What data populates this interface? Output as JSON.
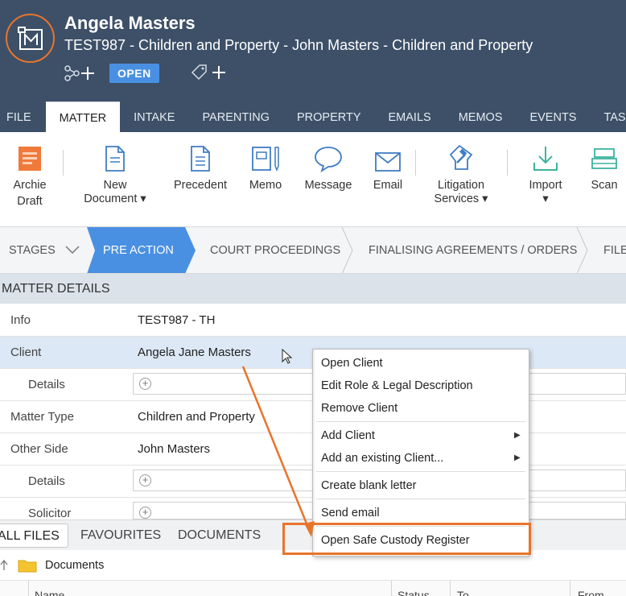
{
  "header": {
    "client_name": "Angela Masters",
    "matter_title": "TEST987 - Children and Property - John Masters - Children and Property",
    "status": "OPEN",
    "icons": [
      "matter-logo-icon",
      "relationship-icon",
      "add-icon",
      "tag-icon",
      "add-icon"
    ]
  },
  "tabs": [
    "FILE",
    "MATTER",
    "INTAKE",
    "PARENTING",
    "PROPERTY",
    "EMAILS",
    "MEMOS",
    "EVENTS",
    "TASKS"
  ],
  "active_tab": "MATTER",
  "ribbon": {
    "archie_draft": [
      "Archie",
      "Draft"
    ],
    "new_document": [
      "New",
      "Document ▾"
    ],
    "precedent": "Precedent",
    "memo": "Memo",
    "message": "Message",
    "email": "Email",
    "litigation_services": [
      "Litigation",
      "Services ▾"
    ],
    "import": [
      "Import",
      "▾"
    ],
    "scan": "Scan"
  },
  "stages": {
    "label": "STAGES",
    "items": [
      "PRE ACTION",
      "COURT PROCEEDINGS",
      "FINALISING AGREEMENTS / ORDERS",
      "FILE"
    ],
    "active": "PRE ACTION"
  },
  "matter_details": {
    "title": "MATTER DETAILS",
    "rows": [
      {
        "label": "Info",
        "value": "TEST987 - TH"
      },
      {
        "label": "Client",
        "value": "Angela Jane Masters"
      },
      {
        "label": "Details",
        "value": ""
      },
      {
        "label": "Matter Type",
        "value": "Children and Property"
      },
      {
        "label": "Other Side",
        "value": "John Masters"
      },
      {
        "label": "Details",
        "value": ""
      },
      {
        "label": "Solicitor",
        "value": ""
      }
    ]
  },
  "context_menu": {
    "items": [
      "Open Client",
      "Edit Role & Legal Description",
      "Remove Client",
      "Add Client",
      "Add an existing Client...",
      "Create blank letter",
      "Send email",
      "Open Safe Custody Register"
    ],
    "highlighted": "Open Safe Custody Register"
  },
  "files": {
    "tabs": [
      "ALL FILES",
      "FAVOURITES",
      "DOCUMENTS"
    ],
    "active_tab": "ALL FILES",
    "folder": "Documents",
    "columns": [
      "Name",
      "Status",
      "To",
      "From"
    ]
  },
  "colors": {
    "header_bg": "#3d5068",
    "accent_orange": "#e8742c",
    "status_blue": "#4a90e2",
    "stage_active": "#4a90e2",
    "selected_row": "#dce8f5"
  }
}
